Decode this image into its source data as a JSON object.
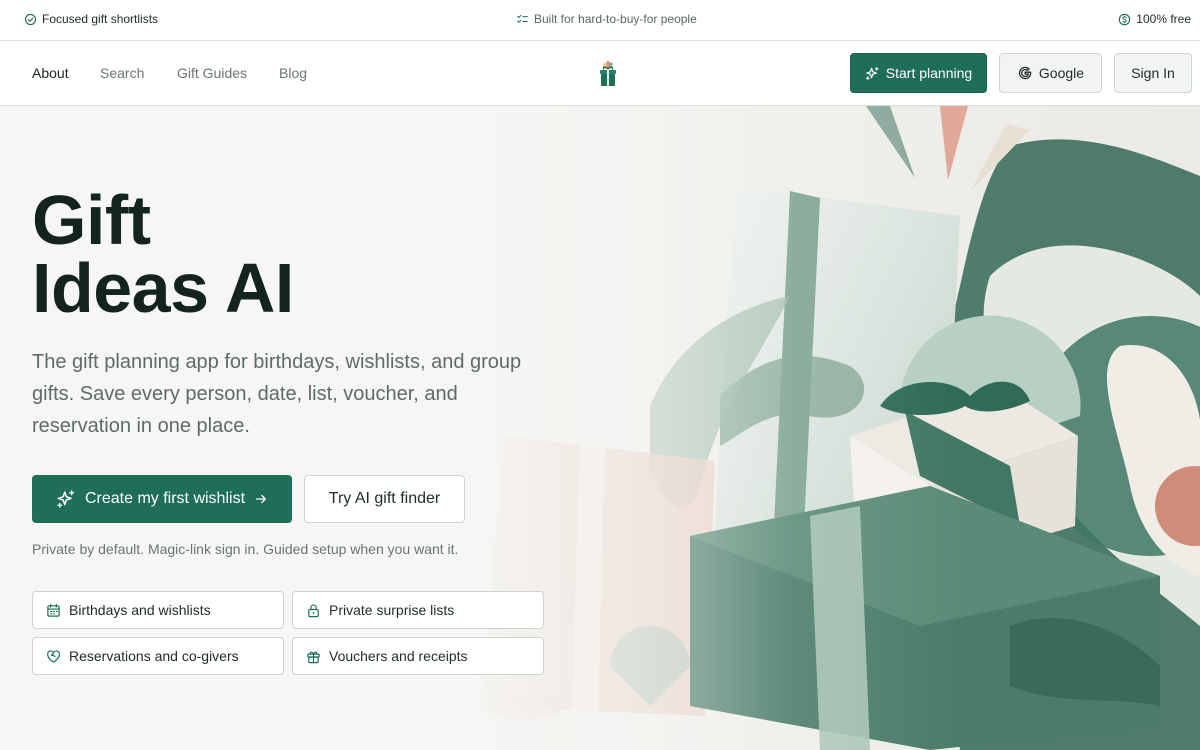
{
  "topbar": {
    "left": "Focused gift shortlists",
    "middle": "Built for hard-to-buy-for people",
    "right": "100% free"
  },
  "nav": {
    "links": [
      "About",
      "Search",
      "Gift Guides",
      "Blog"
    ],
    "start_label": "Start planning",
    "google_label": "Google",
    "signin_label": "Sign In"
  },
  "hero": {
    "title_line1": "Gift",
    "title_line2": "Ideas AI",
    "subtitle": "The gift planning app for birthdays, wishlists, and group gifts. Save every person, date, list, voucher, and reservation in one place.",
    "cta_primary": "Create my first wishlist",
    "cta_secondary": "Try AI gift finder",
    "note": "Private by default. Magic-link sign in. Guided setup when you want it.",
    "features": [
      {
        "label": "Birthdays and wishlists",
        "icon": "calendar-icon"
      },
      {
        "label": "Private surprise lists",
        "icon": "lock-icon"
      },
      {
        "label": "Reservations and co-givers",
        "icon": "heart-handshake-icon"
      },
      {
        "label": "Vouchers and receipts",
        "icon": "gift-icon"
      }
    ]
  },
  "colors": {
    "accent": "#1f6e58",
    "text": "#132420",
    "muted": "#5e6b66"
  }
}
